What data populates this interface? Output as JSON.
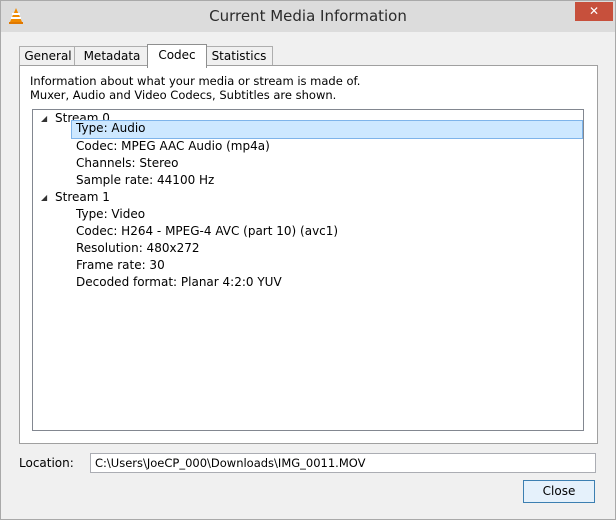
{
  "window": {
    "title": "Current Media Information"
  },
  "tabs": [
    {
      "label": "General",
      "active": false
    },
    {
      "label": "Metadata",
      "active": false
    },
    {
      "label": "Codec",
      "active": true
    },
    {
      "label": "Statistics",
      "active": false
    }
  ],
  "codec": {
    "description_line1": "Information about what your media or stream is made of.",
    "description_line2": "Muxer, Audio and Video Codecs, Subtitles are shown.",
    "streams": [
      {
        "label": "Stream 0",
        "expanded": true,
        "properties": [
          {
            "text": "Type: Audio",
            "selected": true
          },
          {
            "text": "Codec: MPEG AAC Audio (mp4a)",
            "selected": false
          },
          {
            "text": "Channels: Stereo",
            "selected": false
          },
          {
            "text": "Sample rate: 44100 Hz",
            "selected": false
          }
        ]
      },
      {
        "label": "Stream 1",
        "expanded": true,
        "properties": [
          {
            "text": "Type: Video",
            "selected": false
          },
          {
            "text": "Codec: H264 - MPEG-4 AVC (part 10) (avc1)",
            "selected": false
          },
          {
            "text": "Resolution: 480x272",
            "selected": false
          },
          {
            "text": "Frame rate: 30",
            "selected": false
          },
          {
            "text": "Decoded format: Planar 4:2:0 YUV",
            "selected": false
          }
        ]
      }
    ]
  },
  "location": {
    "label": "Location:",
    "value": "C:\\Users\\JoeCP_000\\Downloads\\IMG_0011.MOV"
  },
  "buttons": {
    "close_label": "Close"
  },
  "colors": {
    "selection_bg": "#cde8ff",
    "selection_border": "#7eb4ea",
    "close_button": "#c7503c",
    "button_border": "#3c7fb1"
  }
}
